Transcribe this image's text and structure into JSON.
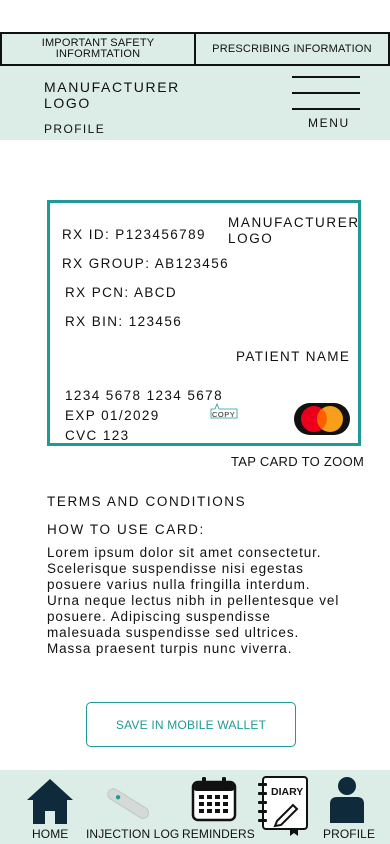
{
  "topbar": {
    "safety_line1": "IMPORTANT SAFETY",
    "safety_line2": "INFORMTATION",
    "prescribing": "PRESCRIBING INFORMATION"
  },
  "header": {
    "logo_line1": "MANUFACTURER",
    "logo_line2": "LOGO",
    "profile": "PROFILE",
    "menu": "MENU"
  },
  "card": {
    "rx_id": "RX ID: P123456789",
    "rx_group": "RX GROUP: AB123456",
    "rx_pcn": "RX PCN: ABCD",
    "rx_bin": "RX BIN: 123456",
    "logo_line1": "MANUFACTURER",
    "logo_line2": "LOGO",
    "patient_name": "PATIENT NAME",
    "number": "1234 5678 1234 5678",
    "exp": "EXP 01/2029",
    "cvc": "CVC 123",
    "copy_label": "COPY",
    "brand_icon": "mastercard-logo",
    "brand_colors": {
      "left": "#eb001b",
      "right": "#f79e1b",
      "overlap": "#ff5f00"
    }
  },
  "tap_to_zoom": "TAP CARD TO ZOOM",
  "terms_title": "TERMS AND CONDITIONS",
  "how_to_title": "HOW TO USE CARD:",
  "body_text": "Lorem ipsum dolor sit amet consectetur. Scelerisque suspendisse nisi egestas posuere varius nulla fringilla interdum. Urna neque lectus nibh in pellentesque vel posuere. Adipiscing suspendisse malesuada suspendisse sed ultrices. Massa praesent turpis nunc viverra.",
  "wallet_button": "SAVE IN MOBILE WALLET",
  "nav": [
    {
      "label": "HOME",
      "icon": "home-icon"
    },
    {
      "label": "INJECTION LOG",
      "icon": "injection-pen-icon"
    },
    {
      "label": "REMINDERS",
      "icon": "calendar-icon"
    },
    {
      "label": "DIARY",
      "icon": "diary-icon"
    },
    {
      "label": "PROFILE",
      "icon": "person-icon"
    }
  ],
  "colors": {
    "accent": "#1f9a96",
    "panel_bg": "#dcece7"
  }
}
